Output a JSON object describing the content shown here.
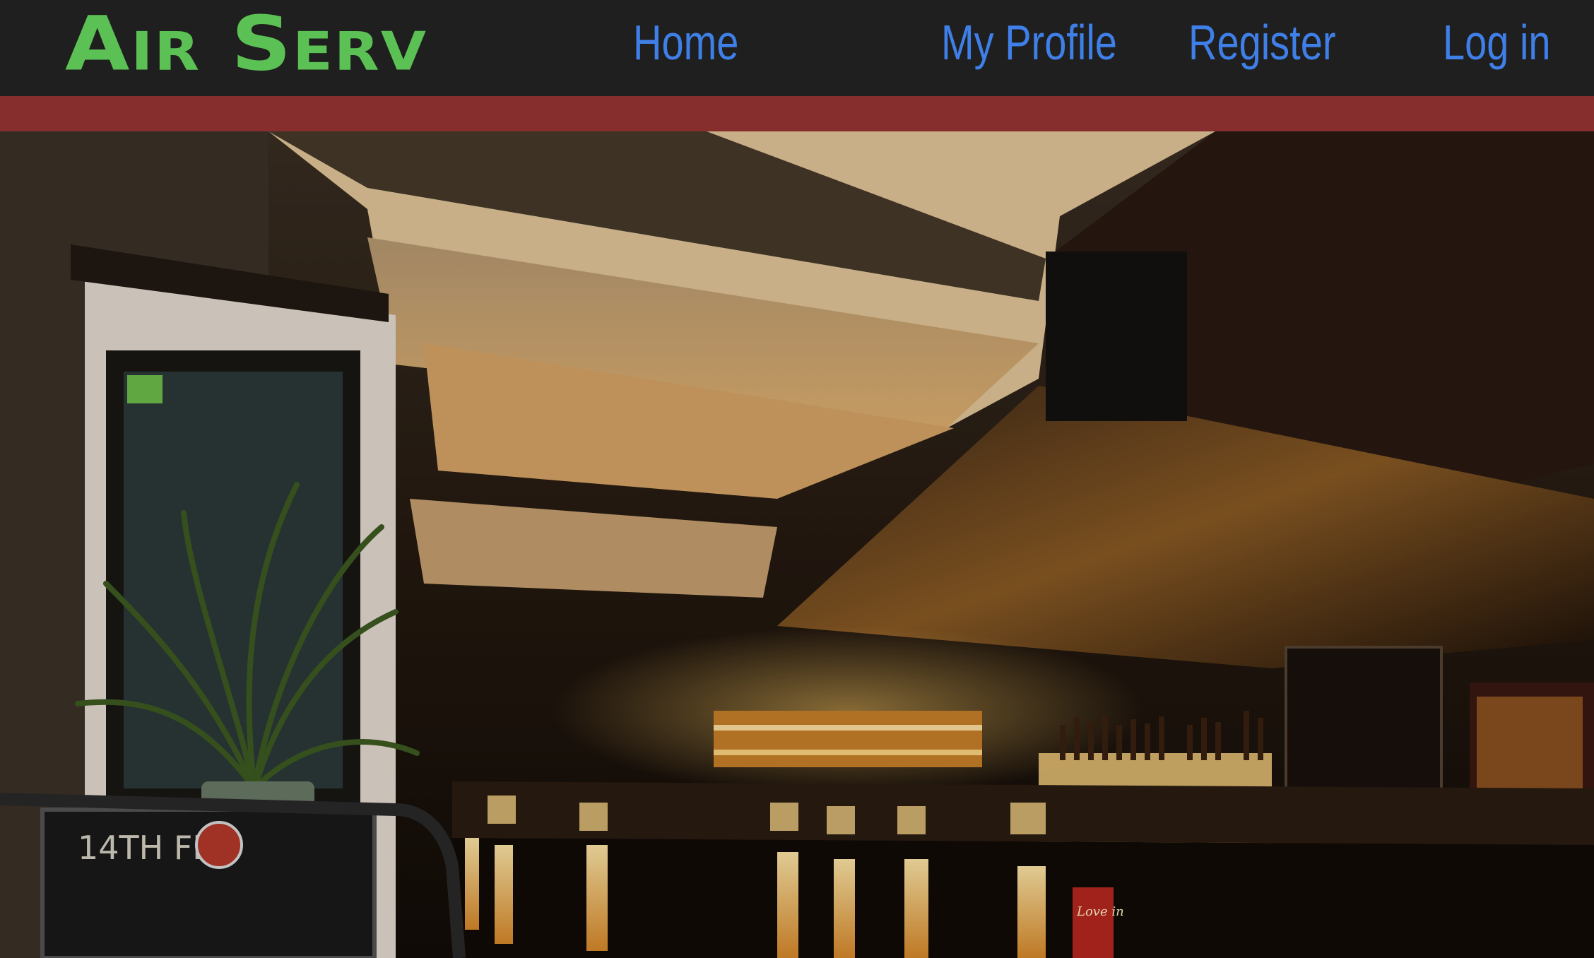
{
  "navbar": {
    "brand": "Air Serv",
    "links": [
      {
        "label": "Home"
      },
      {
        "label": "My Profile"
      },
      {
        "label": "Register"
      },
      {
        "label": "Log in"
      }
    ]
  },
  "hero": {
    "image": "photo of a dimly lit restaurant bar interior with backlit counter",
    "chalkboard_text": "14TH FEB",
    "sign_text": "Love in"
  },
  "colors": {
    "navbar_bg": "#1f1f1f",
    "brand": "#5cc155",
    "link": "#3f7fe8",
    "accent_band": "#862d2d"
  }
}
